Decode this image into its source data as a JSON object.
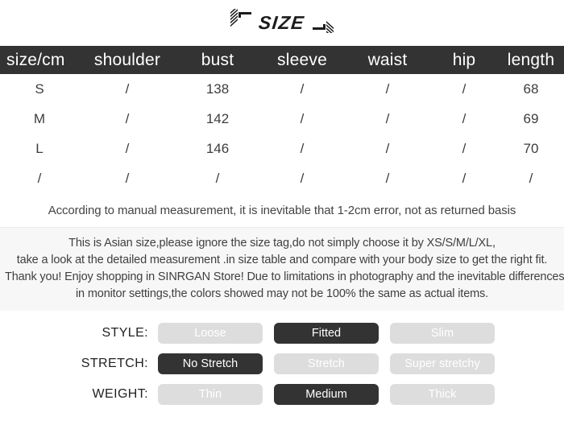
{
  "title": {
    "text": "SIZE",
    "left_ornament": "bracket-ornament-left",
    "right_ornament": "bracket-ornament-right"
  },
  "colors": {
    "header_bar": "#333333",
    "active_pill": "#333333",
    "inactive_pill": "#dddddd",
    "panel_bg": "#f7f7f7",
    "page_bg": "#ffffff",
    "text": "#3d3d3d"
  },
  "table": {
    "headers": [
      "size/cm",
      "shoulder",
      "bust",
      "sleeve",
      "waist",
      "hip",
      "length"
    ],
    "rows": [
      [
        "S",
        "/",
        "138",
        "/",
        "/",
        "/",
        "68"
      ],
      [
        "M",
        "/",
        "142",
        "/",
        "/",
        "/",
        "69"
      ],
      [
        "L",
        "/",
        "146",
        "/",
        "/",
        "/",
        "70"
      ],
      [
        "/",
        "/",
        "/",
        "/",
        "/",
        "/",
        "/"
      ]
    ]
  },
  "measurement_note": "According to manual measurement, it is inevitable that 1-2cm error, not as returned basis",
  "info_panel": {
    "lines": [
      "This is Asian size,please ignore the size tag,do not simply choose it by XS/S/M/L/XL,",
      "take a look at the detailed measurement .in size table and compare with your body size to get the right fit.",
      "Thank you! Enjoy shopping in SINRGAN Store!  Due to limitations in photography and the inevitable differences",
      "in monitor settings,the colors showed may not be 100% the same as actual items."
    ]
  },
  "attributes": [
    {
      "label": "STYLE:",
      "options": [
        {
          "text": "Loose",
          "selected": false
        },
        {
          "text": "Fitted",
          "selected": true
        },
        {
          "text": "Slim",
          "selected": false
        }
      ]
    },
    {
      "label": "STRETCH:",
      "options": [
        {
          "text": "No Stretch",
          "selected": true
        },
        {
          "text": "Stretch",
          "selected": false
        },
        {
          "text": "Super stretchy",
          "selected": false
        }
      ]
    },
    {
      "label": "WEIGHT:",
      "options": [
        {
          "text": "Thin",
          "selected": false
        },
        {
          "text": "Medium",
          "selected": true
        },
        {
          "text": "Thick",
          "selected": false
        }
      ]
    }
  ]
}
